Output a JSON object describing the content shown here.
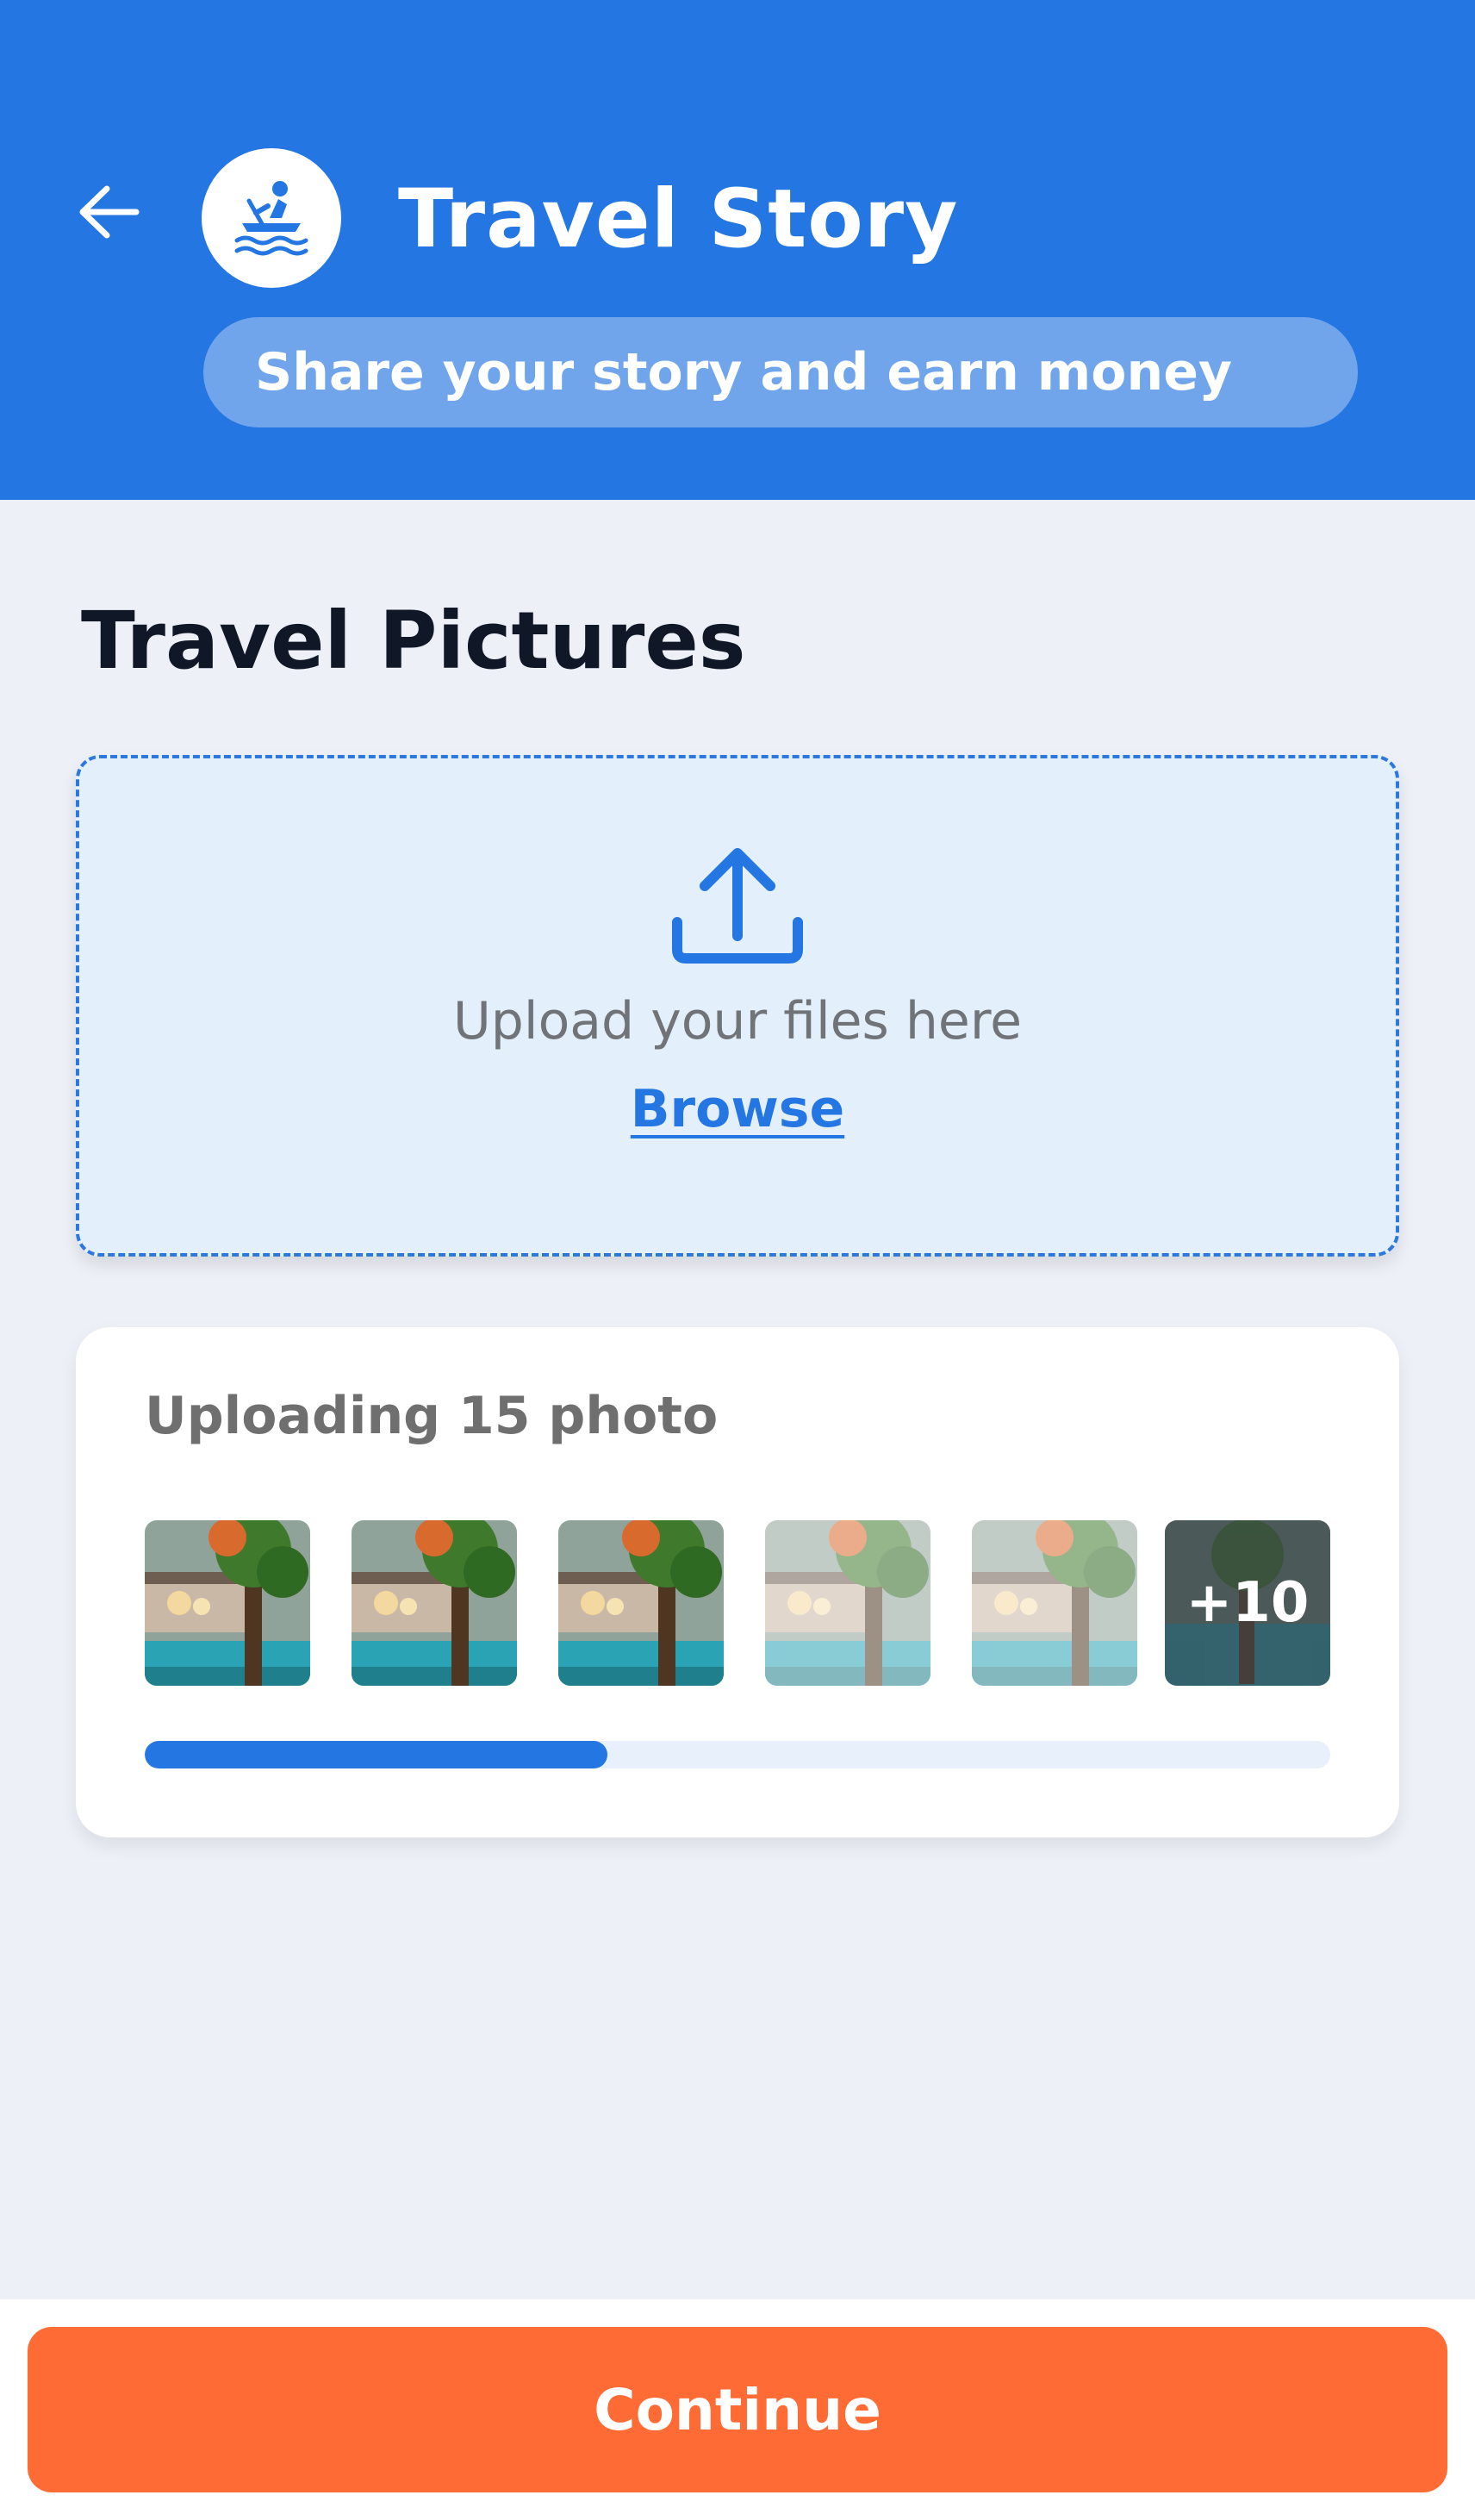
{
  "header": {
    "back_icon": "arrow-left-icon",
    "avatar_icon": "rowing-boat-icon",
    "title": "Travel Story",
    "subtitle": "Share your story and earn money",
    "background_color": "#2476E2"
  },
  "section": {
    "title": "Travel Pictures"
  },
  "upload": {
    "icon": "upload-icon",
    "text": "Upload your files here",
    "browse_label": "Browse"
  },
  "uploading": {
    "title": "Uploading 15 photo",
    "thumbnails": [
      {
        "state": "uploaded"
      },
      {
        "state": "uploaded"
      },
      {
        "state": "uploaded"
      },
      {
        "state": "pending"
      },
      {
        "state": "pending"
      }
    ],
    "more_count": "+10",
    "progress": 0.39,
    "progress_color": "#2476E2"
  },
  "footer": {
    "continue_label": "Continue",
    "button_color": "#FF6B35"
  }
}
